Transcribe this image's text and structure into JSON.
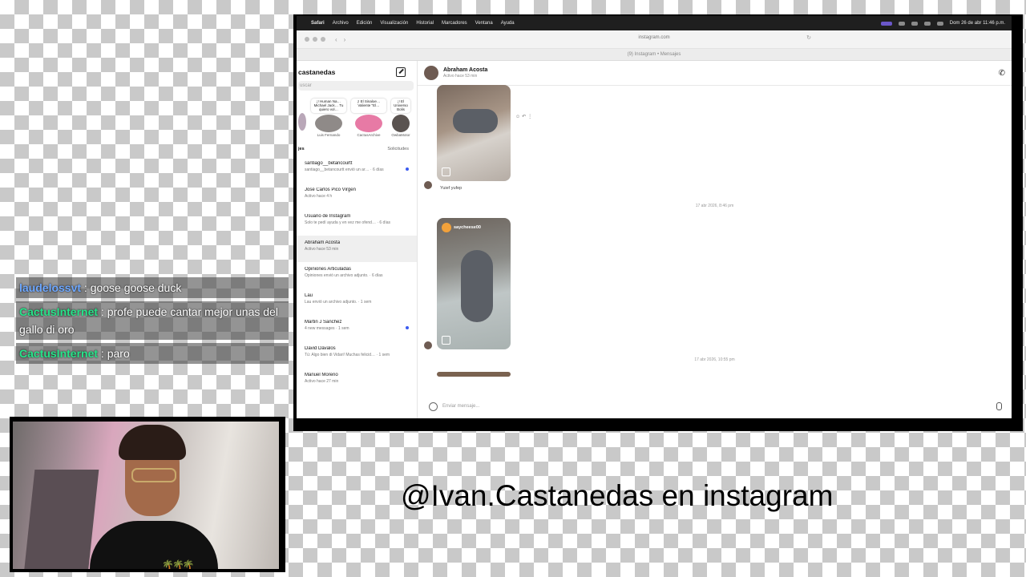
{
  "macos_menubar": {
    "items": [
      "Safari",
      "Archivo",
      "Edición",
      "Visualización",
      "Historial",
      "Marcadores",
      "Ventana",
      "Ayuda"
    ],
    "clock": "Dom 26 de abr  11:46 p.m."
  },
  "browser": {
    "url": "instagram.com",
    "tab_title": "(9) Instagram • Mensajes"
  },
  "instagram": {
    "sidebar": {
      "account_name": "castanedas",
      "search_placeholder": "uscar",
      "stories": [
        {
          "note": "",
          "name": ""
        },
        {
          "note": "¡! Human Na… Michael Jack… Tu quiero vol…",
          "name": "Luis Fernando"
        },
        {
          "note": "¡! El Sinaloe… Valiente \"El…",
          "name": "CactusArchive"
        },
        {
          "note": "¡! El Universo Bolis",
          "name": "OwbaMotor"
        }
      ],
      "section_label": "jes",
      "requests_label": "Solicitudes",
      "conversations": [
        {
          "name": "santiago__betancourtt",
          "sub": "santiago__betancourtt envió un ar… · 6 días",
          "unread": true
        },
        {
          "name": "Jose Carlos Pico Virgen",
          "sub": "Activo hace 4 h",
          "unread": false
        },
        {
          "name": "Usuario de Instagram",
          "sub": "Solo te pedí ayuda y en vez me ofend… · 6 días",
          "unread": false
        },
        {
          "name": "Abraham Acosta",
          "sub": "Activo hace 53 min",
          "unread": false,
          "active": true
        },
        {
          "name": "Opiniones Articuladas",
          "sub": "Opiniones envió un archivo adjunto. · 6 días",
          "unread": false
        },
        {
          "name": "Lau",
          "sub": "Lau envió un archivo adjunto. · 1 sem",
          "unread": false
        },
        {
          "name": "Martin J Sanchez",
          "sub": "4 new messages · 1 sem",
          "unread": true
        },
        {
          "name": "David Dávalos",
          "sub": "Tú: Algo bien di Vidari! Muchas felicid… · 1 sem",
          "unread": false
        },
        {
          "name": "Manuel Moreno",
          "sub": "Activo hace 27 min",
          "unread": false
        }
      ]
    },
    "chat": {
      "contact_name": "Abraham Acosta",
      "contact_status": "Activo hace 53 min",
      "message_text": "Yuief yufep",
      "shared_post_user": "saycheese00",
      "timestamp_1": "17 abr 2026, 8:46 pm",
      "timestamp_2": "17 abr 2026, 10:55 pm",
      "composer_placeholder": "Enviar mensaje..."
    }
  },
  "stream_chat": [
    {
      "user": "laudelossvt",
      "message": "goose goose duck",
      "color": "#6ea8ff"
    },
    {
      "user": "CactusInternet",
      "message": "profe puede cantar mejor unas del gallo di oro",
      "color": "#27e58a"
    },
    {
      "user": "CactusInternet",
      "message": "paro",
      "color": "#27e58a"
    }
  ],
  "caption": "@Ivan.Castanedas en instagram"
}
